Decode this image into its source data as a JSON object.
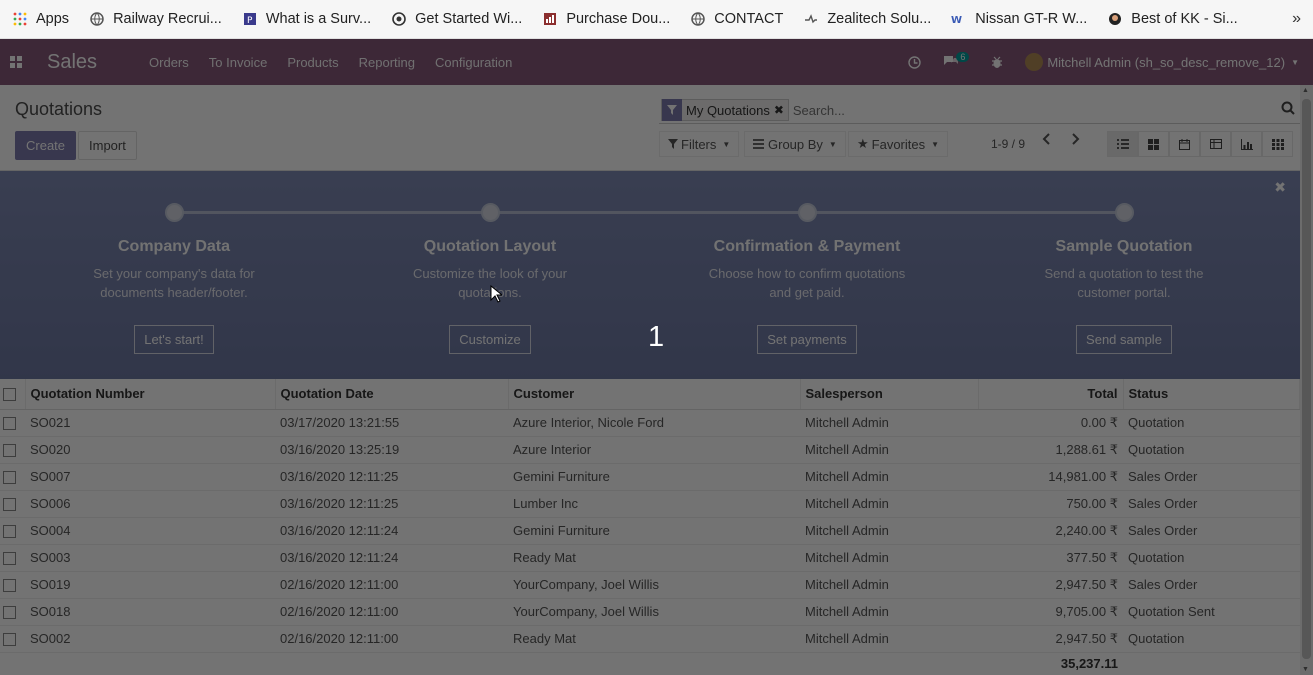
{
  "bookmarks": {
    "items": [
      {
        "label": "Apps",
        "icon": "apps-grid-icon"
      },
      {
        "label": "Railway Recrui...",
        "icon": "globe-icon"
      },
      {
        "label": "What is a Surv...",
        "icon": "bookmark-icon"
      },
      {
        "label": "Get Started Wi...",
        "icon": "wordpress-icon"
      },
      {
        "label": "Purchase Dou...",
        "icon": "chart-icon"
      },
      {
        "label": "CONTACT",
        "icon": "globe-icon"
      },
      {
        "label": "Zealitech Solu...",
        "icon": "zealitech-icon"
      },
      {
        "label": "Nissan GT-R W...",
        "icon": "nissan-icon"
      },
      {
        "label": "Best of KK - Si...",
        "icon": "music-icon"
      }
    ],
    "more": "»"
  },
  "navbar": {
    "brand": "Sales",
    "menu": [
      "Orders",
      "To Invoice",
      "Products",
      "Reporting",
      "Configuration"
    ],
    "chat_badge": "6",
    "user": "Mitchell Admin (sh_so_desc_remove_12)"
  },
  "control": {
    "breadcrumb": "Quotations",
    "create_label": "Create",
    "import_label": "Import",
    "facet_label": "My Quotations",
    "search_placeholder": "Search...",
    "filters_label": "Filters",
    "groupby_label": "Group By",
    "favorites_label": "Favorites",
    "pager": "1-9 / 9"
  },
  "banner": {
    "steps": [
      {
        "title": "Company Data",
        "desc1": "Set your company's data for",
        "desc2": "documents header/footer.",
        "button": "Let's start!"
      },
      {
        "title": "Quotation Layout",
        "desc1": "Customize the look of your",
        "desc2": "quotations.",
        "button": "Customize"
      },
      {
        "title": "Confirmation & Payment",
        "desc1": "Choose how to confirm quotations",
        "desc2": "and get paid.",
        "button": "Set payments"
      },
      {
        "title": "Sample Quotation",
        "desc1": "Send a quotation to test the",
        "desc2": "customer portal.",
        "button": "Send sample"
      }
    ],
    "step_number": "1"
  },
  "table": {
    "headers": [
      "Quotation Number",
      "Quotation Date",
      "Customer",
      "Salesperson",
      "Total",
      "Status"
    ],
    "rows": [
      {
        "number": "SO021",
        "date": "03/17/2020 13:21:55",
        "customer": "Azure Interior, Nicole Ford",
        "salesperson": "Mitchell Admin",
        "total": "0.00 ₹",
        "status": "Quotation"
      },
      {
        "number": "SO020",
        "date": "03/16/2020 13:25:19",
        "customer": "Azure Interior",
        "salesperson": "Mitchell Admin",
        "total": "1,288.61 ₹",
        "status": "Quotation"
      },
      {
        "number": "SO007",
        "date": "03/16/2020 12:11:25",
        "customer": "Gemini Furniture",
        "salesperson": "Mitchell Admin",
        "total": "14,981.00 ₹",
        "status": "Sales Order"
      },
      {
        "number": "SO006",
        "date": "03/16/2020 12:11:25",
        "customer": "Lumber Inc",
        "salesperson": "Mitchell Admin",
        "total": "750.00 ₹",
        "status": "Sales Order"
      },
      {
        "number": "SO004",
        "date": "03/16/2020 12:11:24",
        "customer": "Gemini Furniture",
        "salesperson": "Mitchell Admin",
        "total": "2,240.00 ₹",
        "status": "Sales Order"
      },
      {
        "number": "SO003",
        "date": "03/16/2020 12:11:24",
        "customer": "Ready Mat",
        "salesperson": "Mitchell Admin",
        "total": "377.50 ₹",
        "status": "Quotation"
      },
      {
        "number": "SO019",
        "date": "02/16/2020 12:11:00",
        "customer": "YourCompany, Joel Willis",
        "salesperson": "Mitchell Admin",
        "total": "2,947.50 ₹",
        "status": "Sales Order"
      },
      {
        "number": "SO018",
        "date": "02/16/2020 12:11:00",
        "customer": "YourCompany, Joel Willis",
        "salesperson": "Mitchell Admin",
        "total": "9,705.00 ₹",
        "status": "Quotation Sent"
      },
      {
        "number": "SO002",
        "date": "02/16/2020 12:11:00",
        "customer": "Ready Mat",
        "salesperson": "Mitchell Admin",
        "total": "2,947.50 ₹",
        "status": "Quotation"
      }
    ],
    "grand_total": "35,237.11"
  }
}
